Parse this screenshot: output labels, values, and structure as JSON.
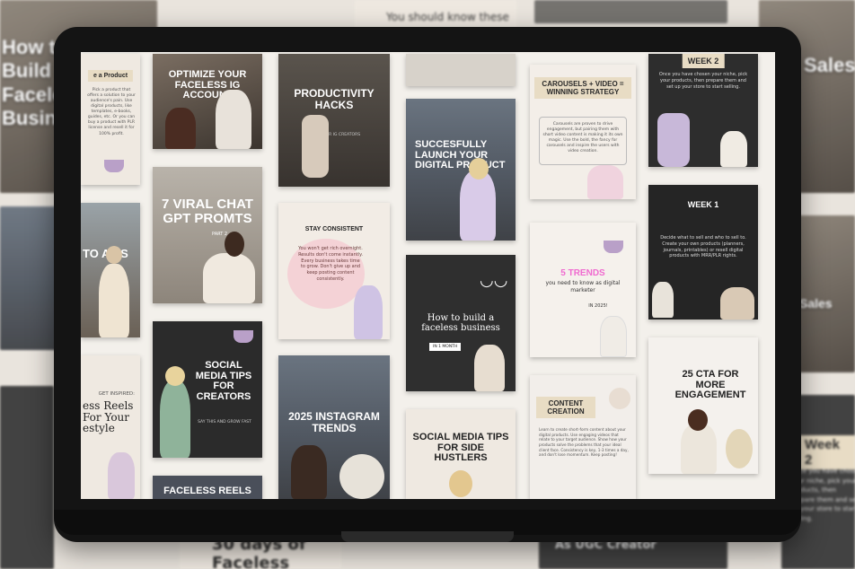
{
  "background": {
    "tiles": [
      {
        "text": "How to Build a Faceless Business"
      },
      {
        "text": "You should know these"
      },
      {
        "text": "Week 2"
      },
      {
        "text": "Week 2"
      },
      {
        "text": "Sales"
      },
      {
        "text": "Faceless Reels For Your Lifestyle"
      },
      {
        "text": "30 days of Faceless"
      },
      {
        "text": "As UGC Creator"
      }
    ],
    "snippet": "Once you have chosen your niche, pick your products, then prepare them and set up your store to start selling."
  },
  "posts": {
    "p1": {
      "title": "e a Product",
      "body": "Pick a product that offers a solution to your audience's pain. Use digital products, like templates, e-books, guides, etc. Or you can buy a product with PLR license and resell it for 100% profit."
    },
    "p2": {
      "title": "OPTIMIZE YOUR FACELESS IG ACCOUNT"
    },
    "p3": {
      "title": "PRODUCTIVITY HACKS",
      "sub": "FOR IG CREATORS"
    },
    "p5": {
      "title": "CAROUSELS + VIDEO = WINNING STRATEGY",
      "body": "Carousels are proven to drive engagement, but pairing them with short video content is making it its own magic. Use the bold, the fancy for carousels and inspire the users with video creation."
    },
    "p6": {
      "title": "WEEK 2",
      "body": "Once you have chosen your niche, pick your products, then prepare them and set up your store to start selling."
    },
    "p7": {
      "title": "SUCCESFULLY LAUNCH YOUR DIGITAL PRODUCT"
    },
    "p8": {
      "title": "7 VIRAL CHAT GPT PROMTS",
      "sub": "PART 2"
    },
    "p9": {
      "title": "STAY CONSISTENT",
      "body": "You won't get rich overnight. Results don't come instantly. Every business takes time to grow. Don't give up and keep posting content consistently."
    },
    "p10": {
      "title": "WEEK 1",
      "body": "Decide what to sell and who to sell to. Create your own products (planners, journals, printables) or resell digital products with MRR/PLR rights."
    },
    "p11": {
      "title": "5 TRENDS",
      "body": "you need to know as digital marketer",
      "sub": "IN 2025!"
    },
    "p12": {
      "title": "TO A SS"
    },
    "p13": {
      "title": "How to build a faceless business",
      "sub": "IN 1 MONTH"
    },
    "p14": {
      "title": "SOCIAL MEDIA TIPS FOR CREATORS",
      "sub": "SAY THIS AND GROW FAST"
    },
    "p15": {
      "title": "2025 INSTAGRAM TRENDS"
    },
    "p16": {
      "title": "25 CTA FOR MORE ENGAGEMENT"
    },
    "p17": {
      "title": "CONTENT CREATION",
      "body": "Learn to create short-form content about your digital products. Use engaging videos that relate to your target audience. Show how your products solve the problems that your ideal client face. Consistency is key, 1-3 times a day, and don't lose momentum. Keep posting!"
    },
    "p18": {
      "title": "ess Reels For Your estyle",
      "sub": "GET INSPIRED:"
    },
    "p19": {
      "title": "SOCIAL MEDIA TIPS FOR SIDE HUSTLERS"
    },
    "p20": {
      "title": "FACELESS REELS"
    }
  }
}
